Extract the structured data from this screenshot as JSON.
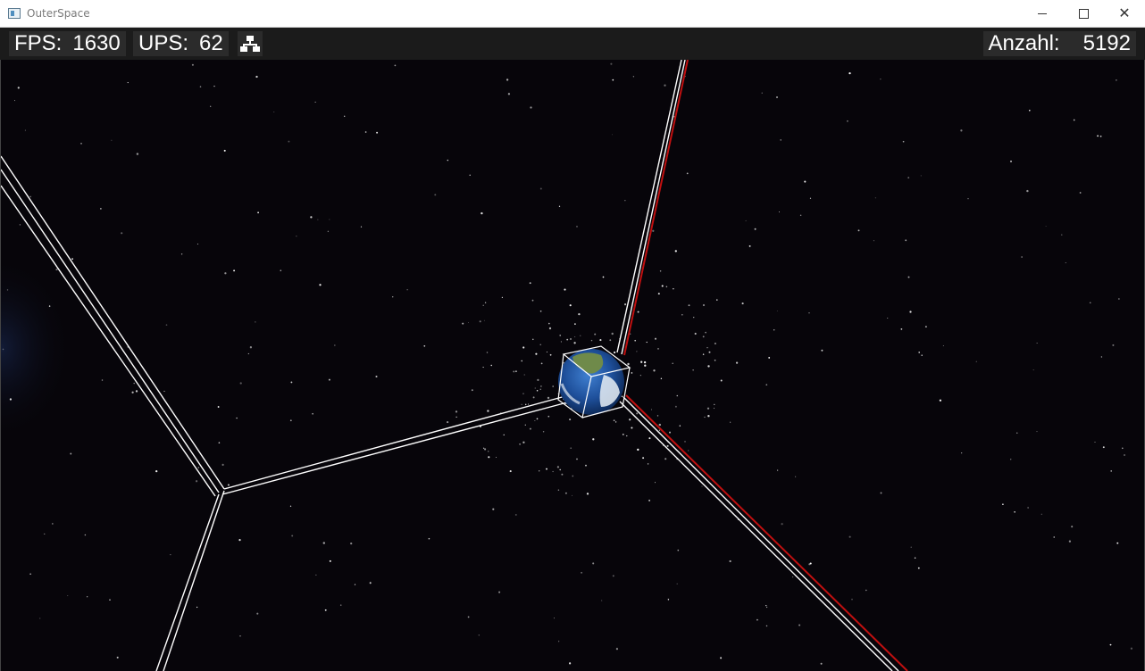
{
  "window": {
    "title": "OuterSpace",
    "controls": {
      "minimize": "minimize-icon",
      "maximize": "maximize-icon",
      "close": "close-icon"
    }
  },
  "hud": {
    "fps_label": "FPS:",
    "fps_value": "1630",
    "ups_label": "UPS:",
    "ups_value": "62",
    "network_icon": "network-topology-icon",
    "count_label": "Anzahl:",
    "count_value": "5192"
  },
  "scene": {
    "background_color": "#07050a",
    "wireframe_color": "#ffffff",
    "axis_highlight_color": "#c01010",
    "planet": "earth-cube"
  }
}
